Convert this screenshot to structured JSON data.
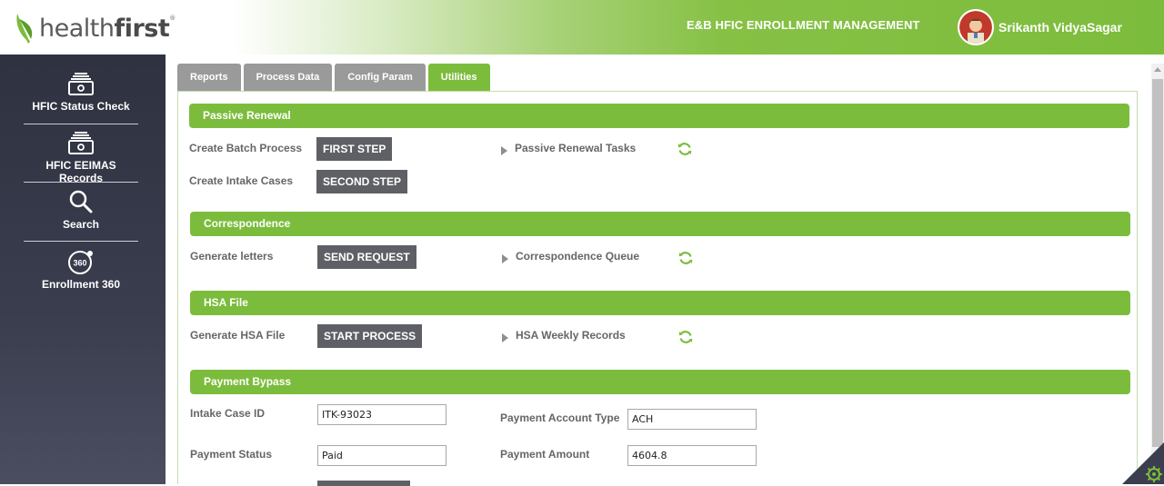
{
  "header": {
    "logo_text_light": "health",
    "logo_text_bold": "first",
    "logo_tm": "®",
    "app_title": "E&B HFIC ENROLLMENT MANAGEMENT",
    "user_name": "Srikanth VidyaSagar"
  },
  "sidebar": {
    "items": [
      {
        "label": "HFIC Status Check",
        "icon": "money-stack-icon"
      },
      {
        "label": "HFIC EEIMAS Records",
        "icon": "money-stack-icon"
      },
      {
        "label": "Search",
        "icon": "search-icon"
      },
      {
        "label": "Enrollment 360",
        "icon": "360-icon",
        "icon_text": "360"
      }
    ]
  },
  "tabs": [
    {
      "label": "Reports",
      "active": false
    },
    {
      "label": "Process Data",
      "active": false
    },
    {
      "label": "Config Param",
      "active": false
    },
    {
      "label": "Utilities",
      "active": true
    }
  ],
  "sections": {
    "passive_renewal": {
      "title": "Passive Renewal",
      "row1_label": "Create Batch Process",
      "row1_button": "FIRST STEP",
      "row2_label": "Create Intake Cases",
      "row2_button": "SECOND STEP",
      "tasks_label": "Passive Renewal Tasks"
    },
    "correspondence": {
      "title": "Correspondence",
      "row1_label": "Generate letters",
      "row1_button": "SEND REQUEST",
      "queue_label": "Correspondence Queue"
    },
    "hsa_file": {
      "title": "HSA File",
      "row1_label": "Generate HSA File",
      "row1_button": "START PROCESS",
      "records_label": "HSA Weekly Records"
    },
    "payment_bypass": {
      "title": "Payment Bypass",
      "intake_case_id_label": "Intake Case ID",
      "intake_case_id_value": "ITK-93023",
      "payment_account_type_label": "Payment Account Type",
      "payment_account_type_value": "ACH",
      "payment_status_label": "Payment Status",
      "payment_status_value": "Paid",
      "payment_amount_label": "Payment Amount",
      "payment_amount_value": "4604.8"
    }
  },
  "colors": {
    "brand_green": "#7cbc3c",
    "sidebar_dark": "#2f3240",
    "button_gray": "#5e6065",
    "tab_gray": "#9a9a9a"
  }
}
